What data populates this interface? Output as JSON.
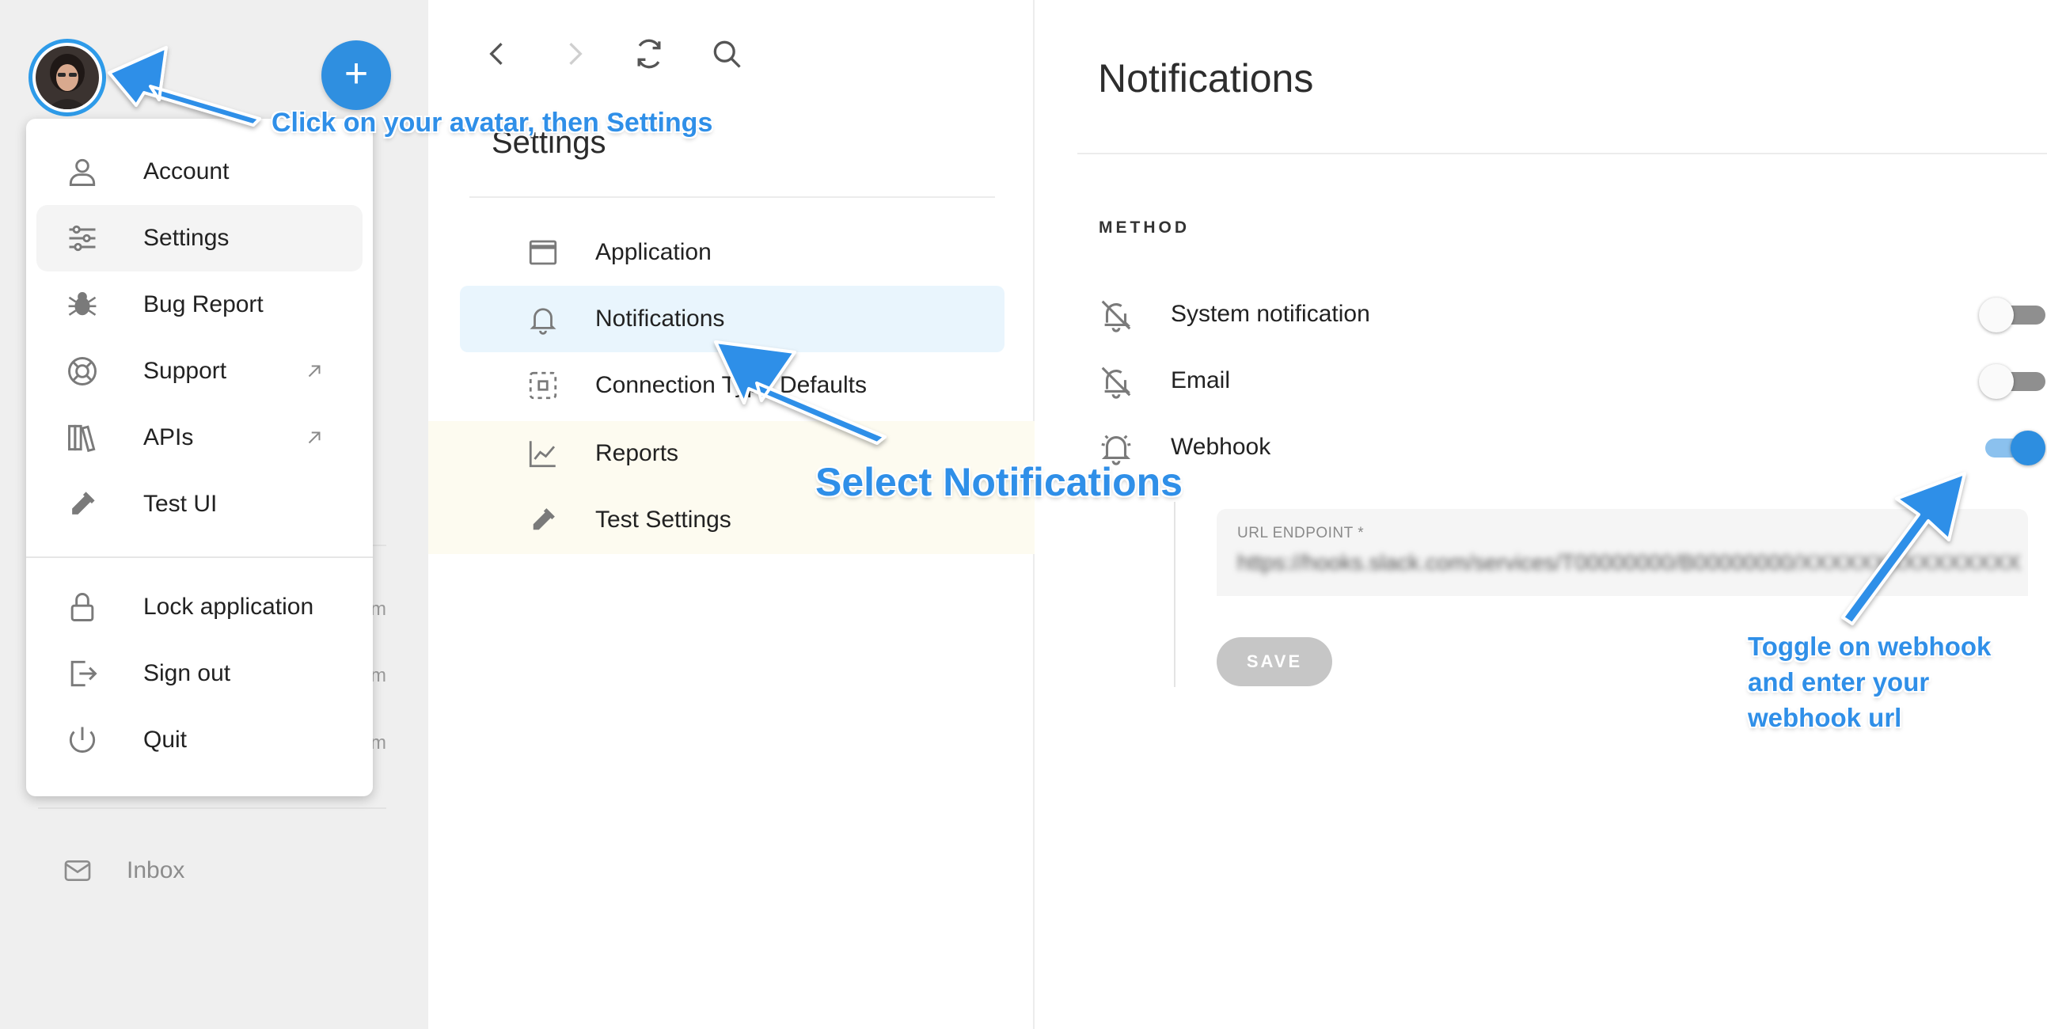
{
  "sidebar": {
    "fab_label": "+",
    "inbox_label": "Inbox",
    "row_markers": [
      "m",
      "m",
      "m"
    ]
  },
  "account_menu": {
    "items": [
      {
        "label": "Account",
        "icon": "person-icon"
      },
      {
        "label": "Settings",
        "icon": "sliders-icon",
        "active": true
      },
      {
        "label": "Bug Report",
        "icon": "bug-icon"
      },
      {
        "label": "Support",
        "icon": "lifebuoy-icon",
        "external": true
      },
      {
        "label": "APIs",
        "icon": "books-icon",
        "external": true
      },
      {
        "label": "Test UI",
        "icon": "pipette-icon"
      },
      {
        "label": "Lock application",
        "icon": "lock-icon"
      },
      {
        "label": "Sign out",
        "icon": "sign-out-icon"
      },
      {
        "label": "Quit",
        "icon": "power-icon"
      }
    ]
  },
  "settings_panel": {
    "title": "Settings",
    "items": [
      {
        "label": "Application",
        "icon": "window-icon"
      },
      {
        "label": "Notifications",
        "icon": "bell-icon",
        "active": true
      },
      {
        "label": "Connection Type Defaults",
        "icon": "dashed-square-icon"
      },
      {
        "label": "Reports",
        "icon": "chart-line-icon"
      },
      {
        "label": "Test Settings",
        "icon": "pipette-icon"
      }
    ]
  },
  "notifications": {
    "title": "Notifications",
    "method_label": "METHOD",
    "methods": [
      {
        "label": "System notification",
        "icon": "bell-off-icon",
        "enabled": false
      },
      {
        "label": "Email",
        "icon": "bell-off-icon",
        "enabled": false
      },
      {
        "label": "Webhook",
        "icon": "bell-ringing-icon",
        "enabled": true
      }
    ],
    "url_field_label": "URL ENDPOINT *",
    "url_field_value": "https://hooks.slack.com/services/T00000000/B00000000/XXXXXXXXXXXXXXXXXXXXXXXX",
    "save_label": "SAVE"
  },
  "annotations": {
    "avatar_hint": "Click on your avatar, then Settings",
    "notifications_hint": "Select Notifications",
    "webhook_hint": "Toggle on webhook and enter your webhook url"
  },
  "colors": {
    "accent": "#2f8fe0",
    "annotation": "#2f8fe8",
    "active_item_bg": "#e9f5fd",
    "sidebar_bg": "#efefef"
  }
}
